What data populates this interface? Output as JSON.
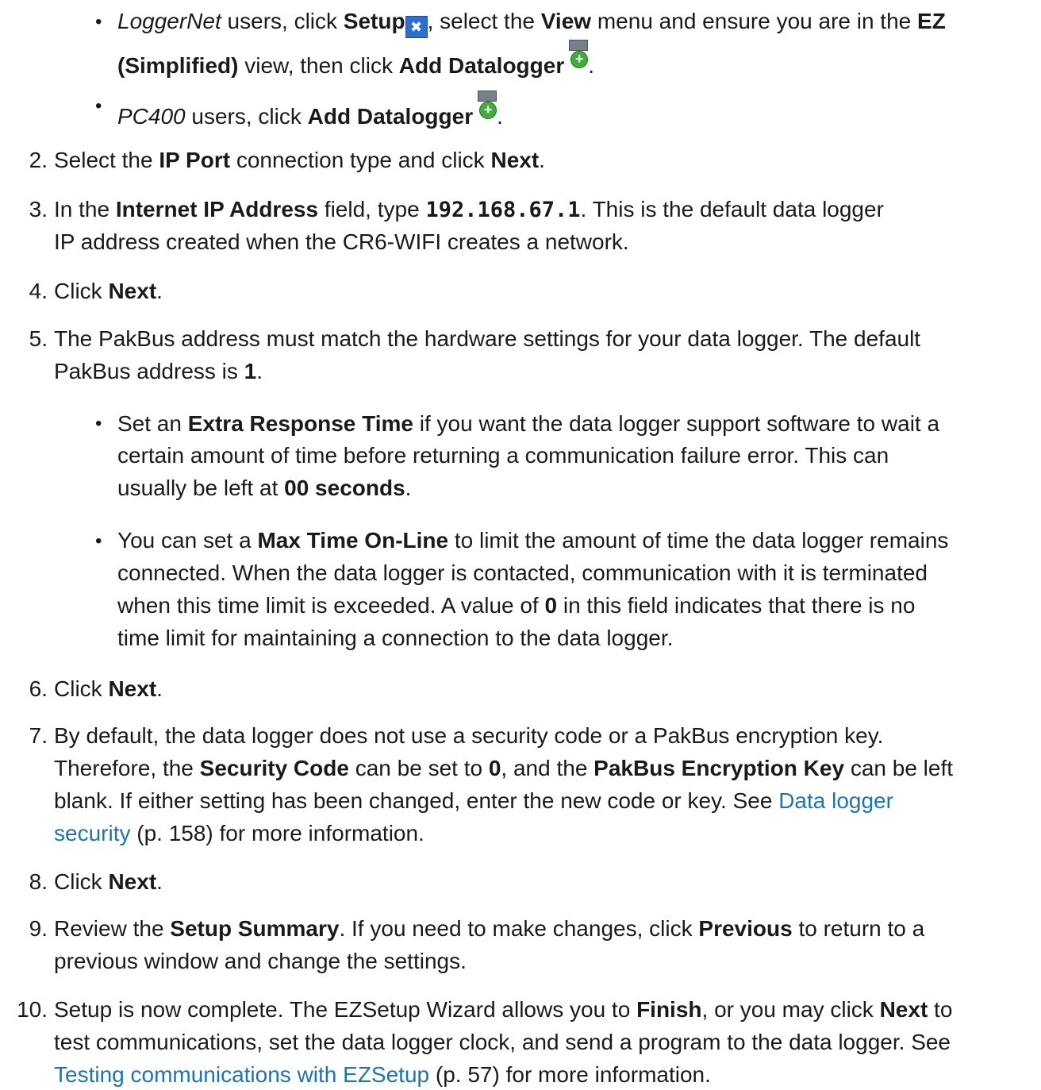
{
  "bullets_top": [
    {
      "app": "LoggerNet",
      "t1": " users, click ",
      "b1": "Setup",
      "t2": ", select the ",
      "b2": "View",
      "t3": " menu and ensure you are in the ",
      "b3": "EZ",
      "b3b": "(Simplified)",
      "t4": " view, then click ",
      "b4": "Add Datalogger",
      "t5": "."
    },
    {
      "app": "PC400",
      "t1": " users, click ",
      "b1": "Add Datalogger",
      "t2": "."
    }
  ],
  "steps": {
    "s2": {
      "num": "2.",
      "t1": "Select the ",
      "b1": "IP Port",
      "t2": " connection type and click ",
      "b2": "Next",
      "t3": "."
    },
    "s3": {
      "num": "3.",
      "t1": "In the ",
      "b1": "Internet IP Address",
      "t2": " field, type ",
      "code": "192.168.67.1",
      "t3": ". This is the default data logger",
      "l2": "IP address created when the CR6-WIFI creates a network."
    },
    "s4": {
      "num": "4.",
      "t1": "Click ",
      "b1": "Next",
      "t2": "."
    },
    "s5": {
      "num": "5.",
      "l1": "The PakBus address must match the hardware settings for your data logger. The default",
      "l2a": "PakBus address is ",
      "l2b": "1",
      "l2c": ".",
      "sub1": {
        "t1": "Set an ",
        "b1": "Extra Response Time",
        "t2": " if you want the data logger support software to wait a",
        "l2": "certain amount of time before returning a communication failure error. This can",
        "l3a": "usually be left at ",
        "l3b": "00 seconds",
        "l3c": "."
      },
      "sub2": {
        "t1": "You can set a ",
        "b1": "Max Time On-Line",
        "t2": " to limit the amount of time the data logger remains",
        "l2": "connected. When the data logger is contacted, communication with it is terminated",
        "l3a": "when this time limit is exceeded. A value of ",
        "l3b": "0",
        "l3c": " in this field indicates that there is no",
        "l4": "time limit for maintaining a connection to the data logger."
      }
    },
    "s6": {
      "num": "6.",
      "t1": "Click ",
      "b1": "Next",
      "t2": "."
    },
    "s7": {
      "num": "7.",
      "l1": "By default, the data logger does not use a security code or a PakBus encryption key.",
      "l2a": "Therefore, the ",
      "l2b": "Security Code",
      "l2c": " can be set to ",
      "l2d": "0",
      "l2e": ", and the ",
      "l2f": "PakBus Encryption Key",
      "l2g": " can be left",
      "l3a": "blank. If either setting has been changed, enter the new code or key. See ",
      "l3link": "Data logger",
      "l4link": "security",
      "l4b": " (p. 158) for more information."
    },
    "s8": {
      "num": "8.",
      "t1": "Click ",
      "b1": "Next",
      "t2": "."
    },
    "s9": {
      "num": "9.",
      "t1": "Review the ",
      "b1": "Setup Summary",
      "t2": ". If you need to make changes, click ",
      "b2": "Previous",
      "t3": " to return to a",
      "l2": "previous window and change the settings."
    },
    "s10": {
      "num": "10.",
      "t1": "Setup is now complete. The EZSetup Wizard allows you to ",
      "b1": "Finish",
      "t2": ", or you may click ",
      "b2": "Next",
      "t3": " to",
      "l2": "test communications, set the data logger clock, and send a program to the data logger. See",
      "l3link": "Testing communications with EZSetup",
      "l3b": " (p. 57) for more information."
    }
  },
  "icons": {
    "setup_glyph": "✖",
    "add_glyph": "+"
  }
}
